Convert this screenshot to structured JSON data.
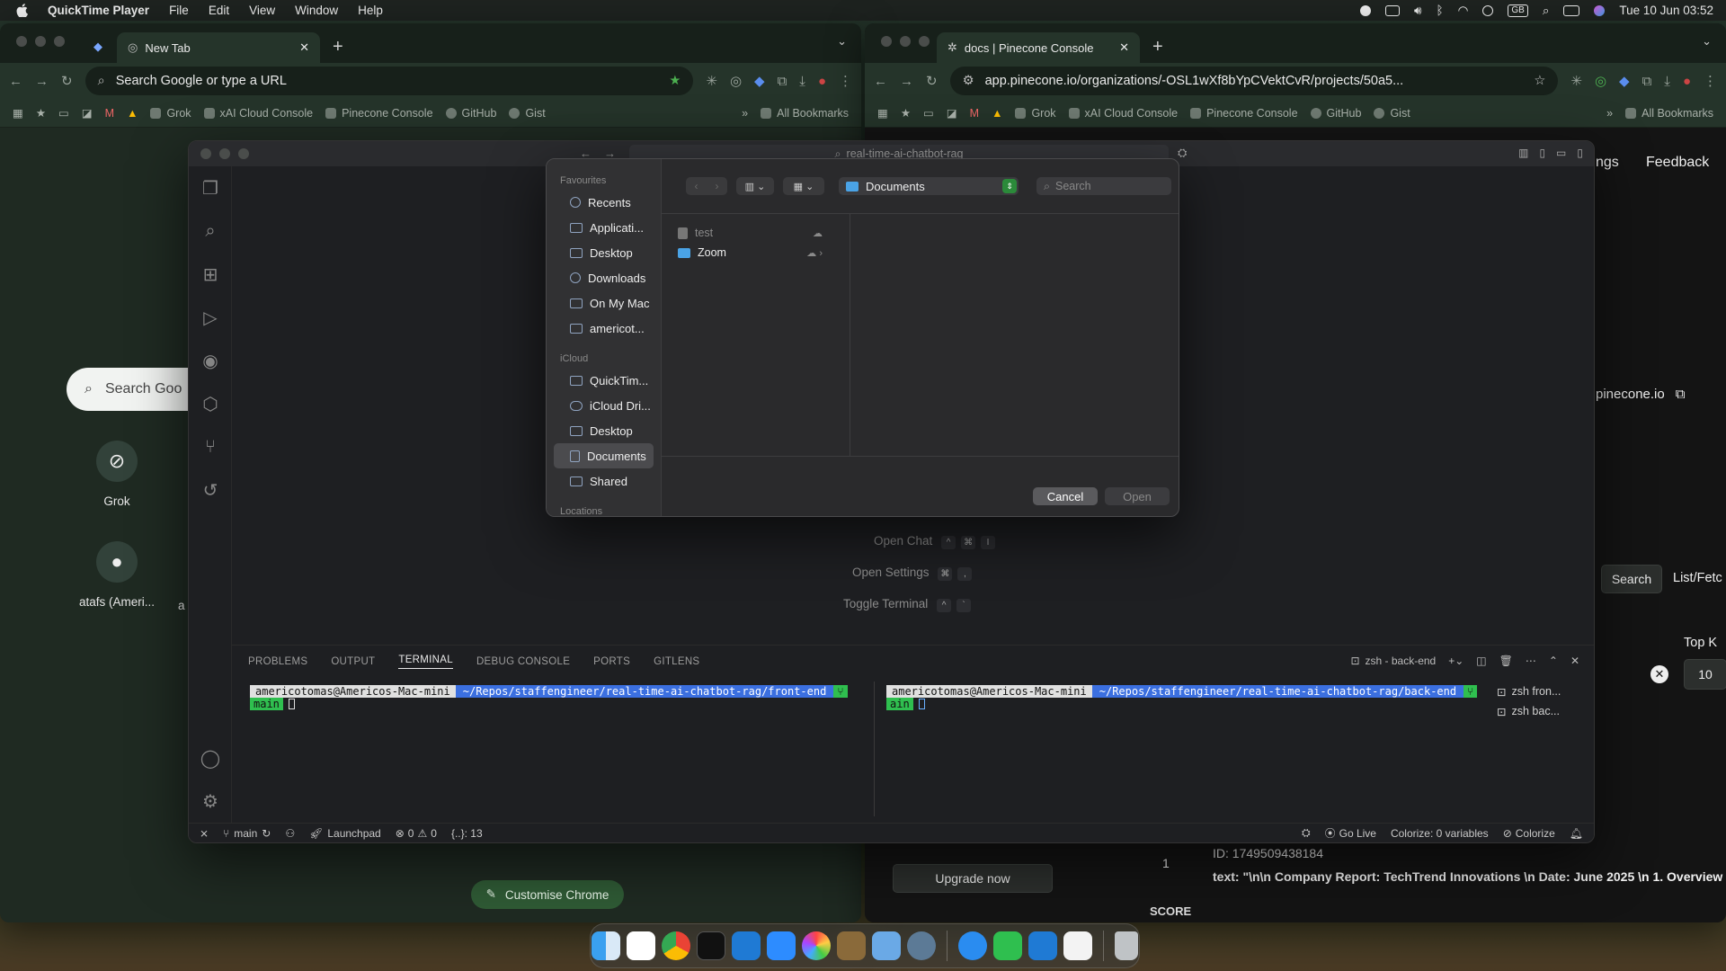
{
  "menubar": {
    "app_name": "QuickTime Player",
    "menus": [
      "File",
      "Edit",
      "View",
      "Window",
      "Help"
    ],
    "clock": "Tue 10 Jun  03:52",
    "input_source": "GB"
  },
  "chrome_left": {
    "tab_title": "New Tab",
    "omnibox_placeholder": "Search Google or type a URL",
    "bookmarks": [
      "Grok",
      "xAI Cloud Console",
      "Pinecone Console",
      "GitHub",
      "Gist"
    ],
    "all_bookmarks": "All Bookmarks",
    "ntp_search": "Search Goo",
    "shortcuts": [
      {
        "label": "Grok",
        "icon": "grok-icon"
      },
      {
        "label": "atafs (Ameri...",
        "icon": "github-icon"
      }
    ],
    "shortcut_partial": "a",
    "customise_label": "Customise Chrome"
  },
  "chrome_right": {
    "tab_title": "docs | Pinecone Console",
    "url": "app.pinecone.io/organizations/-OSL1wXf8bYpCVektCvR/projects/50a5...",
    "bookmarks": [
      "Grok",
      "xAI Cloud Console",
      "Pinecone Console",
      "GitHub",
      "Gist"
    ],
    "all_bookmarks": "All Bookmarks"
  },
  "pinecone": {
    "nav_partial": "ngs",
    "feedback": "Feedback",
    "host_partial": "pinecone.io",
    "search_button": "Search",
    "list_fetch": "List/Fetc",
    "top_k_label": "Top K",
    "top_k_value": "10",
    "upgrade": "Upgrade now",
    "result_index": "1",
    "result_id": "ID: 1749509438184",
    "result_text": "text: \"\\n\\n Company Report: TechTrend Innovations \\n Date: June 2025 \\n 1. Overview",
    "score_label": "SCORE"
  },
  "vscode": {
    "command_center": "real-time-ai-chatbot-rag",
    "hints": [
      {
        "label": "Open Chat",
        "keys": [
          "^",
          "⌘",
          "I"
        ]
      },
      {
        "label": "Open Settings",
        "keys": [
          "⌘",
          ","
        ]
      },
      {
        "label": "Toggle Terminal",
        "keys": [
          "^",
          "`"
        ]
      }
    ],
    "panel_tabs": [
      "PROBLEMS",
      "OUTPUT",
      "TERMINAL",
      "DEBUG CONSOLE",
      "PORTS",
      "GITLENS"
    ],
    "active_panel_tab": "TERMINAL",
    "terminal_title": "zsh - back-end",
    "terminals": [
      {
        "user": "americotomas@Americos-Mac-mini",
        "path": "~/Repos/staffengineer/real-time-ai-chatbot-rag/front-end",
        "branch": "main"
      },
      {
        "user": "americotomas@Americos-Mac-mini",
        "path": "~/Repos/staffengineer/real-time-ai-chatbot-rag/back-end",
        "branch": "ain"
      }
    ],
    "terminal_list": [
      "zsh fron...",
      "zsh bac..."
    ],
    "status": {
      "branch": "main",
      "launchpad": "Launchpad",
      "errors": "0",
      "warnings": "0",
      "braces": "{..}: 13",
      "golive": "Go Live",
      "colorize_vars": "Colorize: 0 variables",
      "colorize": "Colorize"
    }
  },
  "dialog": {
    "favourites_label": "Favourites",
    "favourites": [
      "Recents",
      "Applicati...",
      "Desktop",
      "Downloads",
      "On My Mac",
      "americot..."
    ],
    "icloud_label": "iCloud",
    "icloud": [
      "QuickTim...",
      "iCloud Dri...",
      "Desktop",
      "Documents",
      "Shared"
    ],
    "selected": "Documents",
    "locations_label": "Locations",
    "current_folder": "Documents",
    "search_placeholder": "Search",
    "files": [
      {
        "name": "test",
        "dim": true
      },
      {
        "name": "Zoom",
        "dim": false
      }
    ],
    "cancel": "Cancel",
    "open": "Open"
  },
  "dock": {
    "apps": [
      "finder",
      "slack",
      "chrome",
      "terminal",
      "vscode",
      "zoom",
      "photos",
      "brush",
      "preview",
      "quicktime",
      "safari",
      "numbers",
      "vscode-2",
      "textedit",
      "trash"
    ]
  }
}
